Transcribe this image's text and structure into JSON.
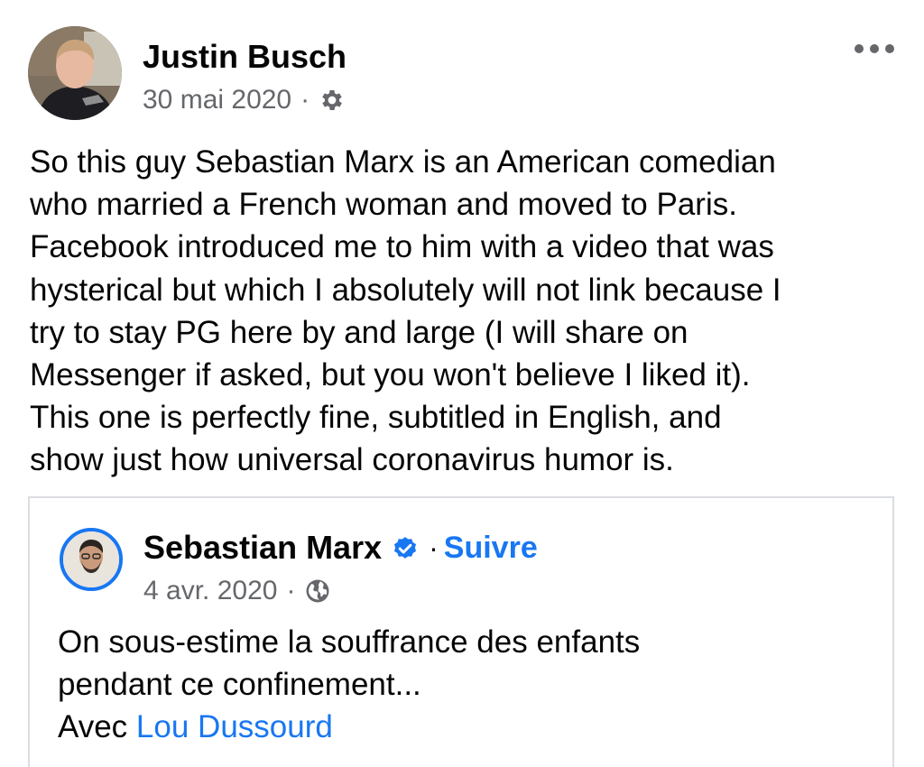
{
  "post": {
    "author": "Justin Busch",
    "date": "30 mai 2020",
    "separator": "·",
    "audience_icon": "gear-icon",
    "more_icon": "more-horizontal-icon",
    "text": "So this guy Sebastian Marx is an American comedian\nwho married a French woman and moved to Paris.\nFacebook introduced me to him with a video that was\nhysterical but which I absolutely will not link because I\ntry to stay PG here by and large (I will share on\nMessenger if asked, but you won't believe I liked it).\nThis one is perfectly fine, subtitled in English, and\nshow just how universal coronavirus humor is."
  },
  "shared": {
    "author": "Sebastian Marx",
    "verified_icon": "verified-badge-icon",
    "separator": "·",
    "follow_label": "Suivre",
    "date": "4 avr. 2020",
    "audience_icon": "globe-icon",
    "text_line1": "On sous-estime la souffrance des enfants",
    "text_line2": "pendant ce confinement...",
    "with_label": "Avec",
    "tagged_name": "Lou Dussourd"
  },
  "colors": {
    "link_blue": "#1877f2",
    "meta_gray": "#65676b",
    "text": "#050505",
    "border": "#dadde1"
  }
}
